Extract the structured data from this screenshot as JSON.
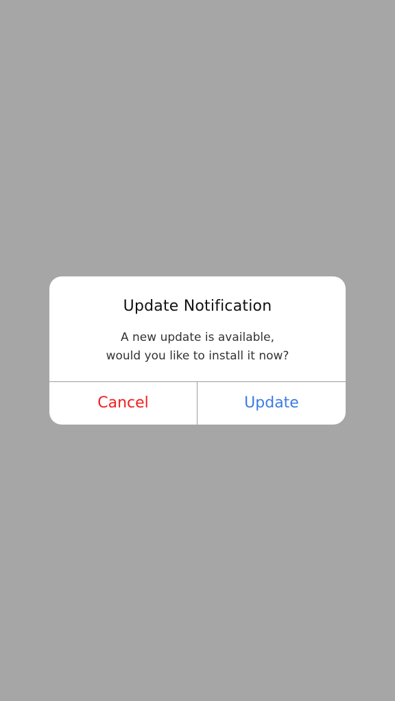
{
  "dialog": {
    "title": "Update Notification",
    "message_line_1": "A new update is available,",
    "message_line_2": "would you like to install it now?",
    "buttons": {
      "cancel": "Cancel",
      "update": "Update"
    }
  },
  "colors": {
    "backdrop": "#a6a6a6",
    "dialog_background": "#ffffff",
    "cancel": "#f21d1d",
    "update": "#3b7be5",
    "divider": "#9c9c9c"
  }
}
